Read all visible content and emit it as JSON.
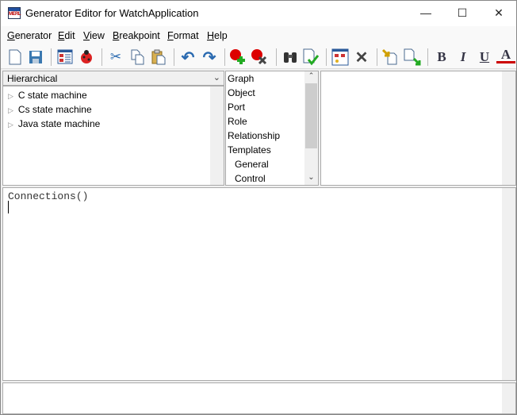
{
  "window": {
    "title": "Generator Editor for WatchApplication",
    "icon_text": "MERL",
    "minimize": "—",
    "maximize": "☐",
    "close": "✕"
  },
  "menu": [
    {
      "label": "Generator",
      "key": "G",
      "rest": "enerator"
    },
    {
      "label": "Edit",
      "key": "E",
      "rest": "dit"
    },
    {
      "label": "View",
      "key": "V",
      "rest": "iew"
    },
    {
      "label": "Breakpoint",
      "key": "B",
      "rest": "reakpoint"
    },
    {
      "label": "Format",
      "key": "F",
      "rest": "ormat"
    },
    {
      "label": "Help",
      "key": "H",
      "rest": "elp"
    }
  ],
  "toolbar": {
    "bold": "B",
    "italic": "I",
    "underline": "U",
    "font_color": "A",
    "font_color_value": "#cc0000"
  },
  "left_pane": {
    "view_mode": "Hierarchical",
    "tree": [
      "C state machine",
      "Cs state machine",
      "Java state machine"
    ]
  },
  "middle_list": {
    "items": [
      "Graph",
      "Object",
      "Port",
      "Role",
      "Relationship",
      "Templates",
      "General",
      "Control"
    ]
  },
  "editor": {
    "text": "Connections()"
  }
}
